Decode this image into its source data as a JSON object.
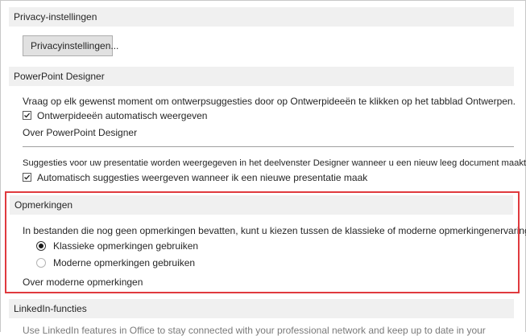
{
  "privacy": {
    "header": "Privacy-instellingen",
    "button_label": "Privacyinstellingen..."
  },
  "designer": {
    "header": "PowerPoint Designer",
    "description": "Vraag op elk gewenst moment om ontwerpsuggesties door op Ontwerpideeën te klikken op het tabblad Ontwerpen.",
    "auto_show_label": "Ontwerpideeën automatisch weergeven",
    "auto_show_checked": true,
    "about_link": "Over PowerPoint Designer",
    "new_doc_description": "Suggesties voor uw presentatie worden weergegeven in het deelvenster Designer wanneer u een nieuw leeg document maakt.",
    "auto_suggest_label": "Automatisch suggesties weergeven wanneer ik een nieuwe presentatie maak",
    "auto_suggest_checked": true
  },
  "comments": {
    "header": "Opmerkingen",
    "description": "In bestanden die nog geen opmerkingen bevatten, kunt u kiezen tussen de klassieke of moderne opmerkingenervaring.",
    "option_classic": "Klassieke opmerkingen gebruiken",
    "option_modern": "Moderne opmerkingen gebruiken",
    "selected": "classic",
    "about_link": "Over moderne opmerkingen",
    "highlight_color": "#e03a3e"
  },
  "linkedin": {
    "header": "LinkedIn-functies",
    "description": "Use LinkedIn features in Office to stay connected with your professional network and keep up to date in your"
  }
}
